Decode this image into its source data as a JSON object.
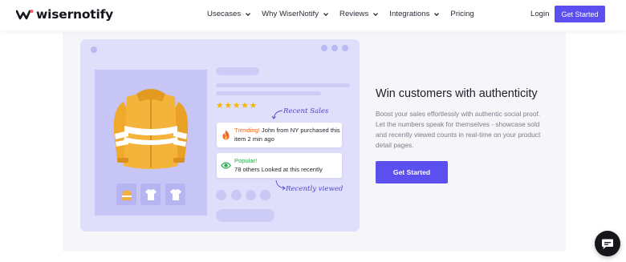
{
  "nav": {
    "logo_text": "wisernotify",
    "logo_icon": "wiser-logo-icon",
    "items": [
      {
        "label": "Usecases",
        "has_dropdown": true
      },
      {
        "label": "Why WiserNotify",
        "has_dropdown": true
      },
      {
        "label": "Reviews",
        "has_dropdown": true
      },
      {
        "label": "Integrations",
        "has_dropdown": true
      },
      {
        "label": "Pricing",
        "has_dropdown": false
      }
    ],
    "login_label": "Login",
    "cta_label": "Get Started"
  },
  "feature": {
    "stars": "★★★★★",
    "annotation_recent": "Recent Sales",
    "annotation_viewed": "Recently viewed",
    "card_trending": {
      "tag": "Trending!",
      "text": " John from NY purchased this item 2 min ago",
      "icon": "fire-icon"
    },
    "card_popular": {
      "tag": "Popular!",
      "text": "78 others Looked at this recently",
      "icon": "eye-icon"
    },
    "heading": "Win customers with authenticity",
    "description": "Boost your sales effortlessly with authentic social proof. Let the numbers speak for themselves - showcase sold and recently viewed counts in real-time on your product detail pages.",
    "cta_label": "Get Started"
  },
  "colors": {
    "brand": "#5b4ff0",
    "mock_bg": "#dfdffb",
    "trending": "#ef6a23",
    "popular": "#2fa84f",
    "star": "#f4b400"
  },
  "chat": {
    "icon": "chat-bubble-icon"
  }
}
